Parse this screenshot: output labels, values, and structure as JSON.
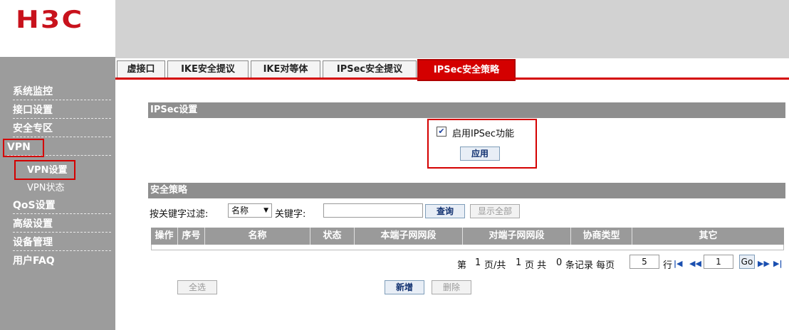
{
  "brand": {
    "logo_text": "H3C",
    "accent": "#d40000"
  },
  "sidebar": {
    "items": [
      {
        "label": "系统监控"
      },
      {
        "label": "接口设置"
      },
      {
        "label": "安全专区"
      },
      {
        "label": "VPN"
      },
      {
        "label": "VPN设置"
      },
      {
        "label": "VPN状态"
      },
      {
        "label": "QoS设置"
      },
      {
        "label": "高级设置"
      },
      {
        "label": "设备管理"
      },
      {
        "label": "用户FAQ"
      }
    ]
  },
  "tabs": [
    {
      "label": "虚接口"
    },
    {
      "label": "IKE安全提议"
    },
    {
      "label": "IKE对等体"
    },
    {
      "label": "IPSec安全提议"
    },
    {
      "label": "IPSec安全策略",
      "active": true
    }
  ],
  "ipsec_settings": {
    "title": "IPSec设置",
    "enable_label": "启用IPSec功能",
    "enabled": true,
    "apply_label": "应用"
  },
  "policy": {
    "title": "安全策略",
    "filter_label": "按关键字过滤:",
    "filter_field_value": "名称",
    "keyword_label": "关键字:",
    "keyword_value": "",
    "query_label": "查询",
    "show_all_label": "显示全部",
    "columns": [
      "操作",
      "序号",
      "名称",
      "状态",
      "本端子网网段",
      "对端子网网段",
      "协商类型",
      "其它"
    ],
    "rows": []
  },
  "pagination": {
    "text_page": "第",
    "current_page": "1",
    "text_of": "页/共",
    "total_pages": "1",
    "text_pages": "页 共",
    "total_records": "0",
    "text_records": "条记录 每页",
    "per_page": "5",
    "text_row": "行",
    "goto_value": "1",
    "go_label": "Go"
  },
  "actions": {
    "select_all_label": "全选",
    "add_label": "新增",
    "delete_label": "删除"
  }
}
